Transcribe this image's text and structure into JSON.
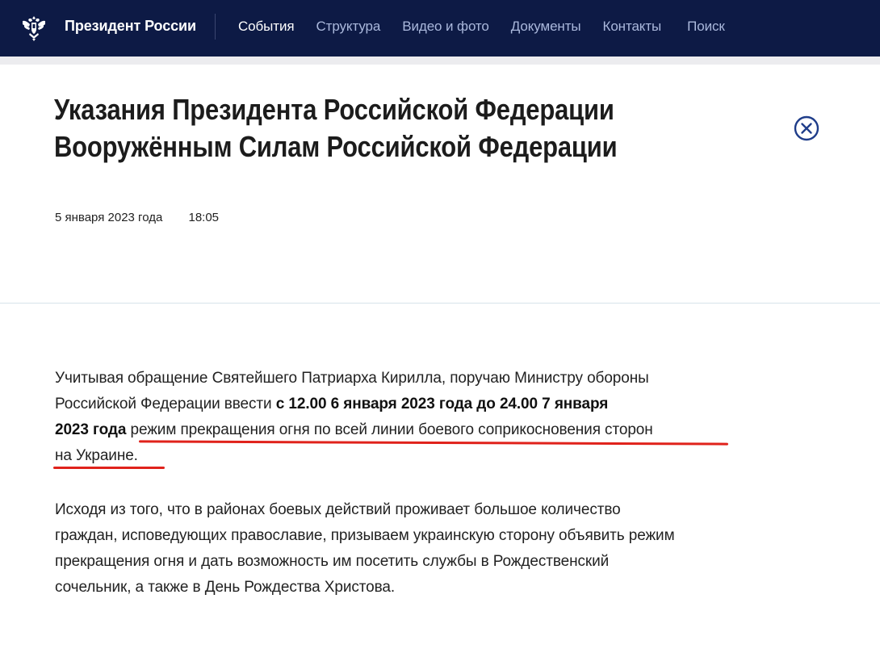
{
  "header": {
    "site_title": "Президент России",
    "nav": [
      {
        "label": "События",
        "active": true
      },
      {
        "label": "Структура",
        "active": false
      },
      {
        "label": "Видео и фото",
        "active": false
      },
      {
        "label": "Документы",
        "active": false
      },
      {
        "label": "Контакты",
        "active": false
      },
      {
        "label": "Поиск",
        "active": false
      }
    ],
    "colors": {
      "bar": "#0d1a45",
      "nav_inactive": "#aab8dc",
      "nav_active": "#ffffff"
    }
  },
  "article": {
    "title_line1": "Указания Президента Российской Федерации",
    "title_line2": "Вооружённым Силам Российской Федерации",
    "date": "5 января 2023 года",
    "time": "18:05",
    "p1": {
      "l1": "Учитывая обращение Святейшего Патриарха Кирилла, поручаю Министру обороны",
      "l2_plain": "Российской Федерации ввести ",
      "l2_bold": "с 12.00 6 января 2023 года до 24.00 7 января",
      "l3_bold": "2023 года",
      "l3_plain": " режим прекращения огня по всей линии боевого соприкосновения сторон",
      "l4": "на Украине."
    },
    "p2": {
      "l1": "Исходя из того, что в районах боевых действий проживает большое количество",
      "l2": "граждан, исповедующих православие, призываем украинскую сторону объявить режим",
      "l3": "прекращения огня и дать возможность им посетить службы в Рождественский",
      "l4": "сочельник, а также в День Рождества Христова."
    },
    "highlight_color": "#e0221b"
  },
  "icons": {
    "emblem": "double-headed-eagle-icon",
    "close": "close-circle-icon"
  }
}
